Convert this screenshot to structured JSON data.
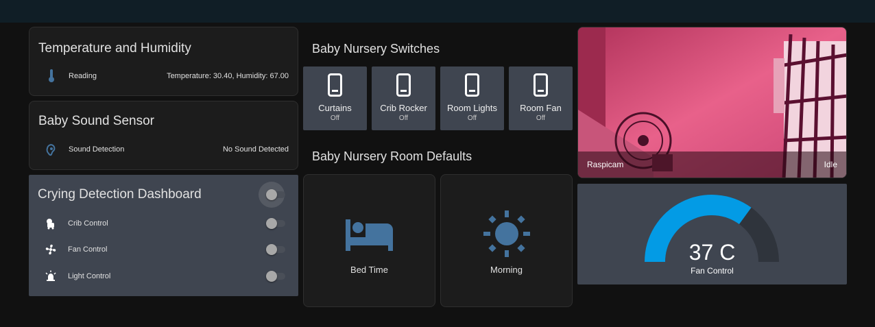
{
  "temp_card": {
    "title": "Temperature and Humidity",
    "row_label": "Reading",
    "row_value": "Temperature: 30.40, Humidity: 67.00",
    "icon": "thermometer-icon"
  },
  "sound_card": {
    "title": "Baby Sound Sensor",
    "row_label": "Sound Detection",
    "row_value": "No Sound Detected",
    "icon": "ear-icon"
  },
  "crying_card": {
    "title": "Crying Detection Dashboard",
    "master_toggle": false,
    "rows": [
      {
        "label": "Crib Control",
        "icon": "crib-icon",
        "on": false
      },
      {
        "label": "Fan Control",
        "icon": "fan-icon",
        "on": false
      },
      {
        "label": "Light Control",
        "icon": "alarm-light-icon",
        "on": false
      }
    ]
  },
  "switches": {
    "title": "Baby Nursery Switches",
    "items": [
      {
        "name": "Curtains",
        "state": "Off",
        "icon": "phone-icon"
      },
      {
        "name": "Crib Rocker",
        "state": "Off",
        "icon": "phone-icon"
      },
      {
        "name": "Room Lights",
        "state": "Off",
        "icon": "phone-icon"
      },
      {
        "name": "Room Fan",
        "state": "Off",
        "icon": "phone-icon"
      }
    ]
  },
  "defaults": {
    "title": "Baby Nursery Room Defaults",
    "items": [
      {
        "name": "Bed Time",
        "icon": "bed-icon"
      },
      {
        "name": "Morning",
        "icon": "sun-icon"
      }
    ]
  },
  "camera": {
    "name": "Raspicam",
    "state": "Idle"
  },
  "gauge": {
    "value_text": "37 C",
    "name": "Fan Control",
    "fraction": 0.7
  },
  "colors": {
    "accent": "#039be5",
    "icon": "#44739e",
    "tile": "#3f4550",
    "card": "#1c1c1c"
  }
}
